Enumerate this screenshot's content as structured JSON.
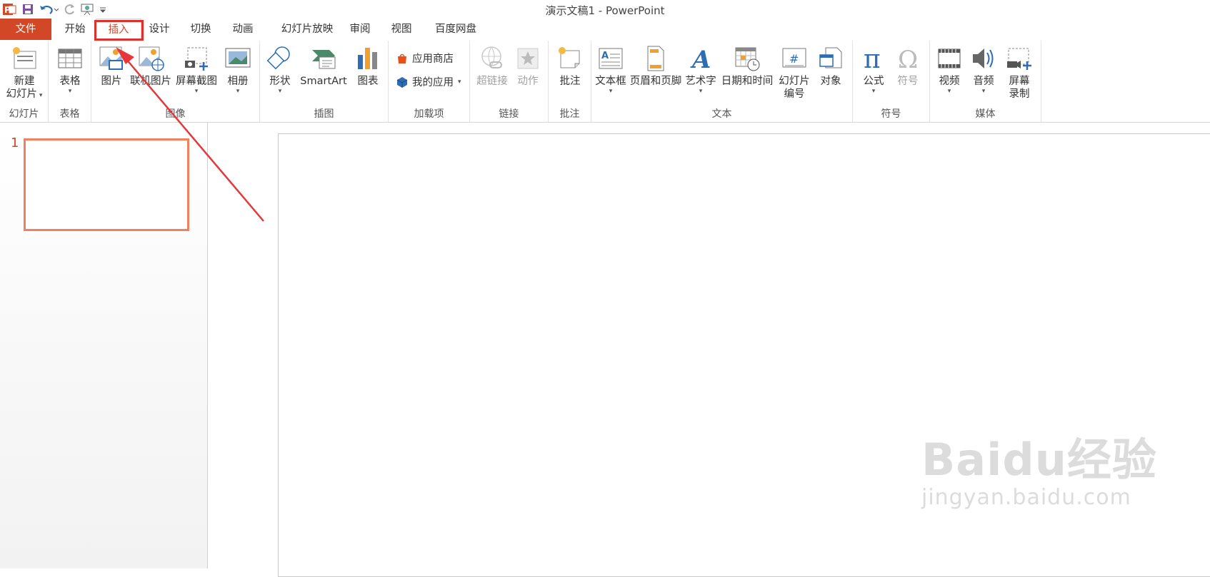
{
  "window": {
    "title": "演示文稿1 - PowerPoint"
  },
  "qat": {
    "icons": [
      "powerpoint-logo-icon",
      "save-icon",
      "undo-icon",
      "redo-icon",
      "start-slideshow-icon",
      "customize-qat-icon"
    ]
  },
  "tabs": [
    {
      "label": "文件"
    },
    {
      "label": "开始"
    },
    {
      "label": "插入"
    },
    {
      "label": "设计"
    },
    {
      "label": "切换"
    },
    {
      "label": "动画"
    },
    {
      "label": "幻灯片放映"
    },
    {
      "label": "审阅"
    },
    {
      "label": "视图"
    },
    {
      "label": "百度网盘"
    }
  ],
  "ribbon": {
    "slides": {
      "label": "幻灯片",
      "new_slide_line1": "新建",
      "new_slide_line2": "幻灯片"
    },
    "tables": {
      "label": "表格",
      "table": "表格"
    },
    "images": {
      "label": "图像",
      "picture": "图片",
      "online_picture": "联机图片",
      "screenshot": "屏幕截图",
      "album": "相册"
    },
    "illustrations": {
      "label": "插图",
      "shapes": "形状",
      "smartart": "SmartArt",
      "chart": "图表"
    },
    "addins": {
      "label": "加载项",
      "store": "应用商店",
      "my_apps": "我的应用"
    },
    "links": {
      "label": "链接",
      "hyperlink": "超链接",
      "action": "动作"
    },
    "comments": {
      "label": "批注",
      "comment": "批注"
    },
    "text": {
      "label": "文本",
      "textbox": "文本框",
      "header_footer": "页眉和页脚",
      "wordart": "艺术字",
      "datetime": "日期和时间",
      "slide_number_line1": "幻灯片",
      "slide_number_line2": "编号",
      "object": "对象"
    },
    "symbols": {
      "label": "符号",
      "equation": "公式",
      "symbol": "符号"
    },
    "media": {
      "label": "媒体",
      "video": "视频",
      "audio": "音频",
      "screen_rec_line1": "屏幕",
      "screen_rec_line2": "录制"
    }
  },
  "thumbnails": {
    "slide_number": "1"
  },
  "watermark": {
    "brand": "Baidu经验",
    "url": "jingyan.baidu.com"
  },
  "colors": {
    "accent": "#d24726",
    "highlight_box": "#e0302c",
    "arrow": "#e8373a"
  }
}
